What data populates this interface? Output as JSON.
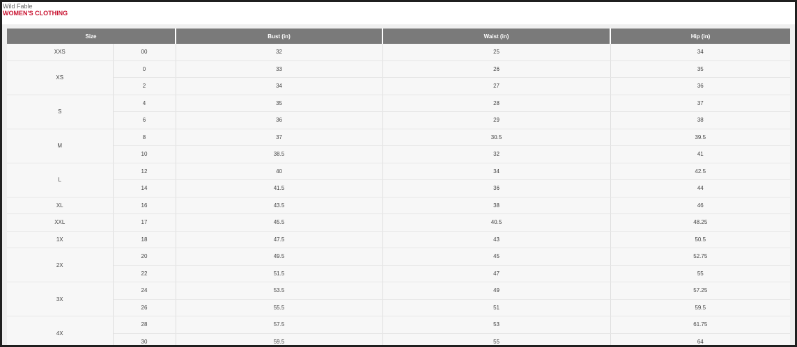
{
  "brand": {
    "name": "Wild Fable",
    "title": "WOMEN'S CLOTHING"
  },
  "table": {
    "headers": {
      "size": "Size",
      "bust": "Bust (in)",
      "waist": "Waist (in)",
      "hip": "Hip (in)"
    },
    "groups": [
      {
        "size": "XXS",
        "rows": [
          {
            "num": "00",
            "bust": "32",
            "waist": "25",
            "hip": "34"
          }
        ]
      },
      {
        "size": "XS",
        "rows": [
          {
            "num": "0",
            "bust": "33",
            "waist": "26",
            "hip": "35"
          },
          {
            "num": "2",
            "bust": "34",
            "waist": "27",
            "hip": "36"
          }
        ]
      },
      {
        "size": "S",
        "rows": [
          {
            "num": "4",
            "bust": "35",
            "waist": "28",
            "hip": "37"
          },
          {
            "num": "6",
            "bust": "36",
            "waist": "29",
            "hip": "38"
          }
        ]
      },
      {
        "size": "M",
        "rows": [
          {
            "num": "8",
            "bust": "37",
            "waist": "30.5",
            "hip": "39.5"
          },
          {
            "num": "10",
            "bust": "38.5",
            "waist": "32",
            "hip": "41"
          }
        ]
      },
      {
        "size": "L",
        "rows": [
          {
            "num": "12",
            "bust": "40",
            "waist": "34",
            "hip": "42.5"
          },
          {
            "num": "14",
            "bust": "41.5",
            "waist": "36",
            "hip": "44"
          }
        ]
      },
      {
        "size": "XL",
        "rows": [
          {
            "num": "16",
            "bust": "43.5",
            "waist": "38",
            "hip": "46"
          }
        ]
      },
      {
        "size": "XXL",
        "rows": [
          {
            "num": "17",
            "bust": "45.5",
            "waist": "40.5",
            "hip": "48.25"
          }
        ]
      },
      {
        "size": "1X",
        "rows": [
          {
            "num": "18",
            "bust": "47.5",
            "waist": "43",
            "hip": "50.5"
          }
        ]
      },
      {
        "size": "2X",
        "rows": [
          {
            "num": "20",
            "bust": "49.5",
            "waist": "45",
            "hip": "52.75"
          },
          {
            "num": "22",
            "bust": "51.5",
            "waist": "47",
            "hip": "55"
          }
        ]
      },
      {
        "size": "3X",
        "rows": [
          {
            "num": "24",
            "bust": "53.5",
            "waist": "49",
            "hip": "57.25"
          },
          {
            "num": "26",
            "bust": "55.5",
            "waist": "51",
            "hip": "59.5"
          }
        ]
      },
      {
        "size": "4X",
        "rows": [
          {
            "num": "28",
            "bust": "57.5",
            "waist": "53",
            "hip": "61.75"
          },
          {
            "num": "30",
            "bust": "59.5",
            "waist": "55",
            "hip": "64"
          }
        ]
      }
    ]
  }
}
